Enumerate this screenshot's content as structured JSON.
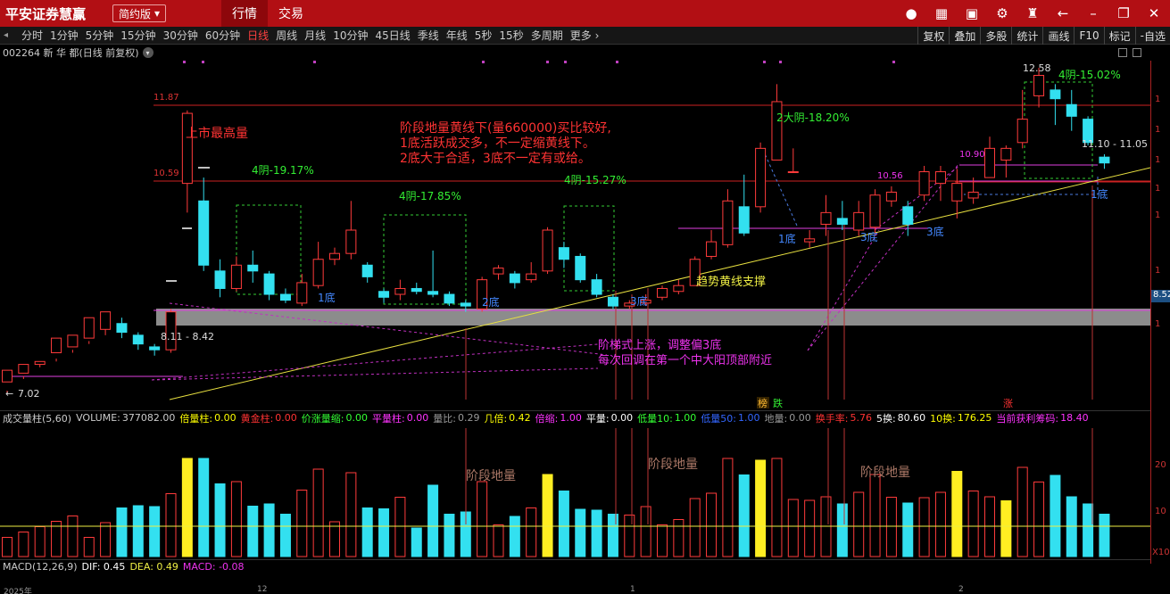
{
  "app": {
    "logo": "平安证券慧赢",
    "mode": "简约版",
    "nav_tabs": [
      "行情",
      "交易"
    ],
    "top_icons": [
      "user-icon",
      "grid-icon",
      "stock-icon",
      "settings-icon",
      "shirt-icon",
      "back-icon",
      "minimize-icon",
      "restore-icon",
      "close-icon"
    ]
  },
  "toolbar": {
    "periods": [
      "分时",
      "1分钟",
      "5分钟",
      "15分钟",
      "30分钟",
      "60分钟",
      "日线",
      "周线",
      "月线",
      "10分钟",
      "45日线",
      "季线",
      "年线",
      "5秒",
      "15秒",
      "多周期",
      "更多"
    ],
    "active_period": "日线",
    "right_tools": [
      "复权",
      "叠加",
      "多股",
      "统计",
      "画线",
      "F10",
      "标记",
      "自选"
    ]
  },
  "stock": {
    "header": "002264 新 华 都(日线 前复权)"
  },
  "chart_data": {
    "type": "candlestick",
    "candles": [
      [
        7.2,
        7.4,
        7.05,
        7.0
      ],
      [
        7.35,
        7.5,
        7.3,
        7.25
      ],
      [
        7.5,
        7.55,
        7.5,
        7.45
      ],
      [
        7.7,
        7.95,
        7.6,
        7.55
      ],
      [
        7.8,
        8.0,
        7.75,
        7.7
      ],
      [
        7.95,
        8.3,
        7.9,
        7.85
      ],
      [
        8.1,
        8.4,
        8.2,
        8.0
      ],
      [
        8.2,
        8.05,
        8.3,
        7.95
      ],
      [
        8.0,
        7.85,
        8.05,
        7.75
      ],
      [
        7.8,
        7.75,
        7.85,
        7.65
      ],
      [
        7.75,
        8.4,
        8.45,
        7.7
      ],
      [
        10.6,
        11.8,
        11.85,
        10.1
      ],
      [
        10.3,
        9.2,
        10.7,
        9.1
      ],
      [
        9.1,
        8.8,
        9.3,
        8.65
      ],
      [
        8.8,
        9.2,
        9.35,
        8.75
      ],
      [
        9.2,
        9.1,
        9.45,
        8.9
      ],
      [
        9.05,
        8.7,
        9.1,
        8.6
      ],
      [
        8.7,
        8.6,
        8.8,
        8.55
      ],
      [
        8.55,
        8.9,
        9.05,
        8.5
      ],
      [
        8.85,
        9.3,
        9.6,
        8.8
      ],
      [
        9.3,
        9.4,
        9.5,
        9.2
      ],
      [
        9.4,
        9.8,
        10.3,
        9.3
      ],
      [
        9.2,
        9.0,
        9.25,
        8.9
      ],
      [
        8.75,
        8.65,
        8.8,
        8.55
      ],
      [
        8.7,
        8.8,
        8.95,
        8.6
      ],
      [
        8.8,
        8.75,
        8.9,
        8.7
      ],
      [
        8.75,
        8.7,
        9.45,
        8.65
      ],
      [
        8.7,
        8.55,
        8.75,
        8.5
      ],
      [
        8.55,
        8.5,
        8.6,
        8.4
      ],
      [
        8.45,
        8.95,
        9.0,
        8.4
      ],
      [
        9.05,
        9.15,
        9.2,
        8.95
      ],
      [
        9.05,
        8.9,
        9.1,
        8.8
      ],
      [
        8.95,
        9.05,
        9.25,
        8.9
      ],
      [
        9.1,
        9.8,
        9.85,
        9.05
      ],
      [
        9.5,
        9.3,
        9.6,
        9.15
      ],
      [
        9.35,
        8.95,
        9.4,
        8.9
      ],
      [
        8.95,
        8.7,
        9.05,
        8.65
      ],
      [
        8.65,
        8.5,
        8.7,
        8.45
      ],
      [
        8.5,
        8.55,
        8.6,
        8.45
      ],
      [
        8.55,
        8.6,
        8.7,
        8.5
      ],
      [
        8.65,
        8.8,
        8.85,
        8.6
      ],
      [
        8.75,
        8.85,
        8.95,
        8.7
      ],
      [
        8.85,
        9.3,
        9.35,
        8.85
      ],
      [
        9.35,
        9.6,
        9.8,
        9.3
      ],
      [
        9.55,
        10.3,
        10.5,
        9.5
      ],
      [
        10.2,
        9.75,
        10.75,
        9.7
      ],
      [
        10.2,
        11.2,
        11.3,
        10.1
      ],
      [
        11.0,
        12.0,
        12.3,
        11.0
      ],
      [
        10.8,
        10.8,
        11.2,
        10.8
      ],
      [
        9.6,
        9.65,
        9.8,
        9.5
      ],
      [
        9.9,
        10.1,
        10.4,
        9.7
      ],
      [
        10.0,
        9.9,
        10.3,
        9.8
      ],
      [
        9.8,
        10.1,
        10.3,
        9.7
      ],
      [
        9.85,
        10.4,
        10.5,
        9.7
      ],
      [
        10.3,
        10.45,
        10.55,
        10.2
      ],
      [
        10.2,
        9.9,
        10.3,
        9.7
      ],
      [
        10.4,
        10.8,
        10.9,
        10.3
      ],
      [
        10.6,
        10.8,
        10.9,
        10.3
      ],
      [
        10.3,
        10.6,
        10.85,
        10.0
      ],
      [
        10.35,
        10.45,
        10.7,
        10.25
      ],
      [
        10.7,
        11.2,
        11.4,
        10.7
      ],
      [
        11.0,
        11.2,
        11.25,
        10.7
      ],
      [
        11.3,
        11.7,
        12.2,
        11.2
      ],
      [
        12.1,
        12.45,
        12.58,
        11.9
      ],
      [
        12.2,
        12.05,
        12.3,
        11.6
      ],
      [
        11.95,
        11.75,
        12.2,
        11.5
      ],
      [
        11.7,
        11.3,
        11.75,
        11.25
      ],
      [
        11.05,
        10.95,
        11.1,
        10.85
      ]
    ],
    "grid": false
  },
  "price_axis_labels": [
    "11.87",
    "10.59"
  ],
  "right_axis": {
    "price_tag": "8.52",
    "ticks": [
      "1",
      "1",
      "1",
      "1",
      "1",
      "1",
      "1"
    ],
    "vol_ticks": [
      "20",
      "10"
    ],
    "vol_unit": "X10"
  },
  "annotations": {
    "listing_high": "上市最高量",
    "note1": "阶段地量黄线下(量660000)买比较好,",
    "note2": "1底活跃成交多，不一定缩黄线下。",
    "note3": "2底大于合适，3底不一定有或给。",
    "yin1": "4阴-19.17%",
    "yin2": "4阴-17.85%",
    "yin3": "4阴-15.27%",
    "yin4": "2大阴-18.20%",
    "yin5": "4阴-15.02%",
    "bottom1": "1底",
    "bottom2": "2底",
    "bottom3": "3底",
    "trend": "趋势黄线支撑",
    "step1": "阶梯式上涨，调整偏3底",
    "step2": "每次回调在第一个中大阳顶部附近",
    "range_label": "8.11 - 8.42",
    "low_label": "7.02",
    "high_label": "12.58",
    "range_label2": "11.10 - 11.05",
    "mid_label1": "10.90",
    "mid_label2": "10.56",
    "bang": "榜",
    "die": "跌",
    "zhang": "涨",
    "vol_note": "阶段地量"
  },
  "volume_header": {
    "name": "成交量柱(5,60)",
    "items": [
      {
        "k": "VOLUME:",
        "v": "377082.00",
        "c": "#cccccc"
      },
      {
        "k": "倍量柱:",
        "v": "0.00",
        "c": "#ffff00"
      },
      {
        "k": "黄金柱:",
        "v": "0.00",
        "c": "#ff3333"
      },
      {
        "k": "价涨量缩:",
        "v": "0.00",
        "c": "#33ff33"
      },
      {
        "k": "平量柱:",
        "v": "0.00",
        "c": "#ff33ff"
      },
      {
        "k": "量比:",
        "v": "0.29",
        "c": "#999999"
      },
      {
        "k": "几倍:",
        "v": "0.42",
        "c": "#ffff00"
      },
      {
        "k": "倍缩:",
        "v": "1.00",
        "c": "#ff33ff"
      },
      {
        "k": "平量:",
        "v": "0.00",
        "c": "#ffffff"
      },
      {
        "k": "低量10:",
        "v": "1.00",
        "c": "#33ff33"
      },
      {
        "k": "低量50:",
        "v": "1.00",
        "c": "#3366ff"
      },
      {
        "k": "地量:",
        "v": "0.00",
        "c": "#999999"
      },
      {
        "k": "换手率:",
        "v": "5.76",
        "c": "#ff3333"
      },
      {
        "k": "5换:",
        "v": "80.60",
        "c": "#ffffff"
      },
      {
        "k": "10换:",
        "v": "176.25",
        "c": "#ffff00"
      },
      {
        "k": "当前获利筹码:",
        "v": "18.40",
        "c": "#ff33ff"
      }
    ]
  },
  "macd_header": {
    "name": "MACD(12,26,9)",
    "dif": "DIF: 0.45",
    "dea": "DEA: 0.49",
    "macd": "MACD: -0.08"
  },
  "bottom_dates": [
    "2025年",
    "12",
    "1",
    "2"
  ]
}
